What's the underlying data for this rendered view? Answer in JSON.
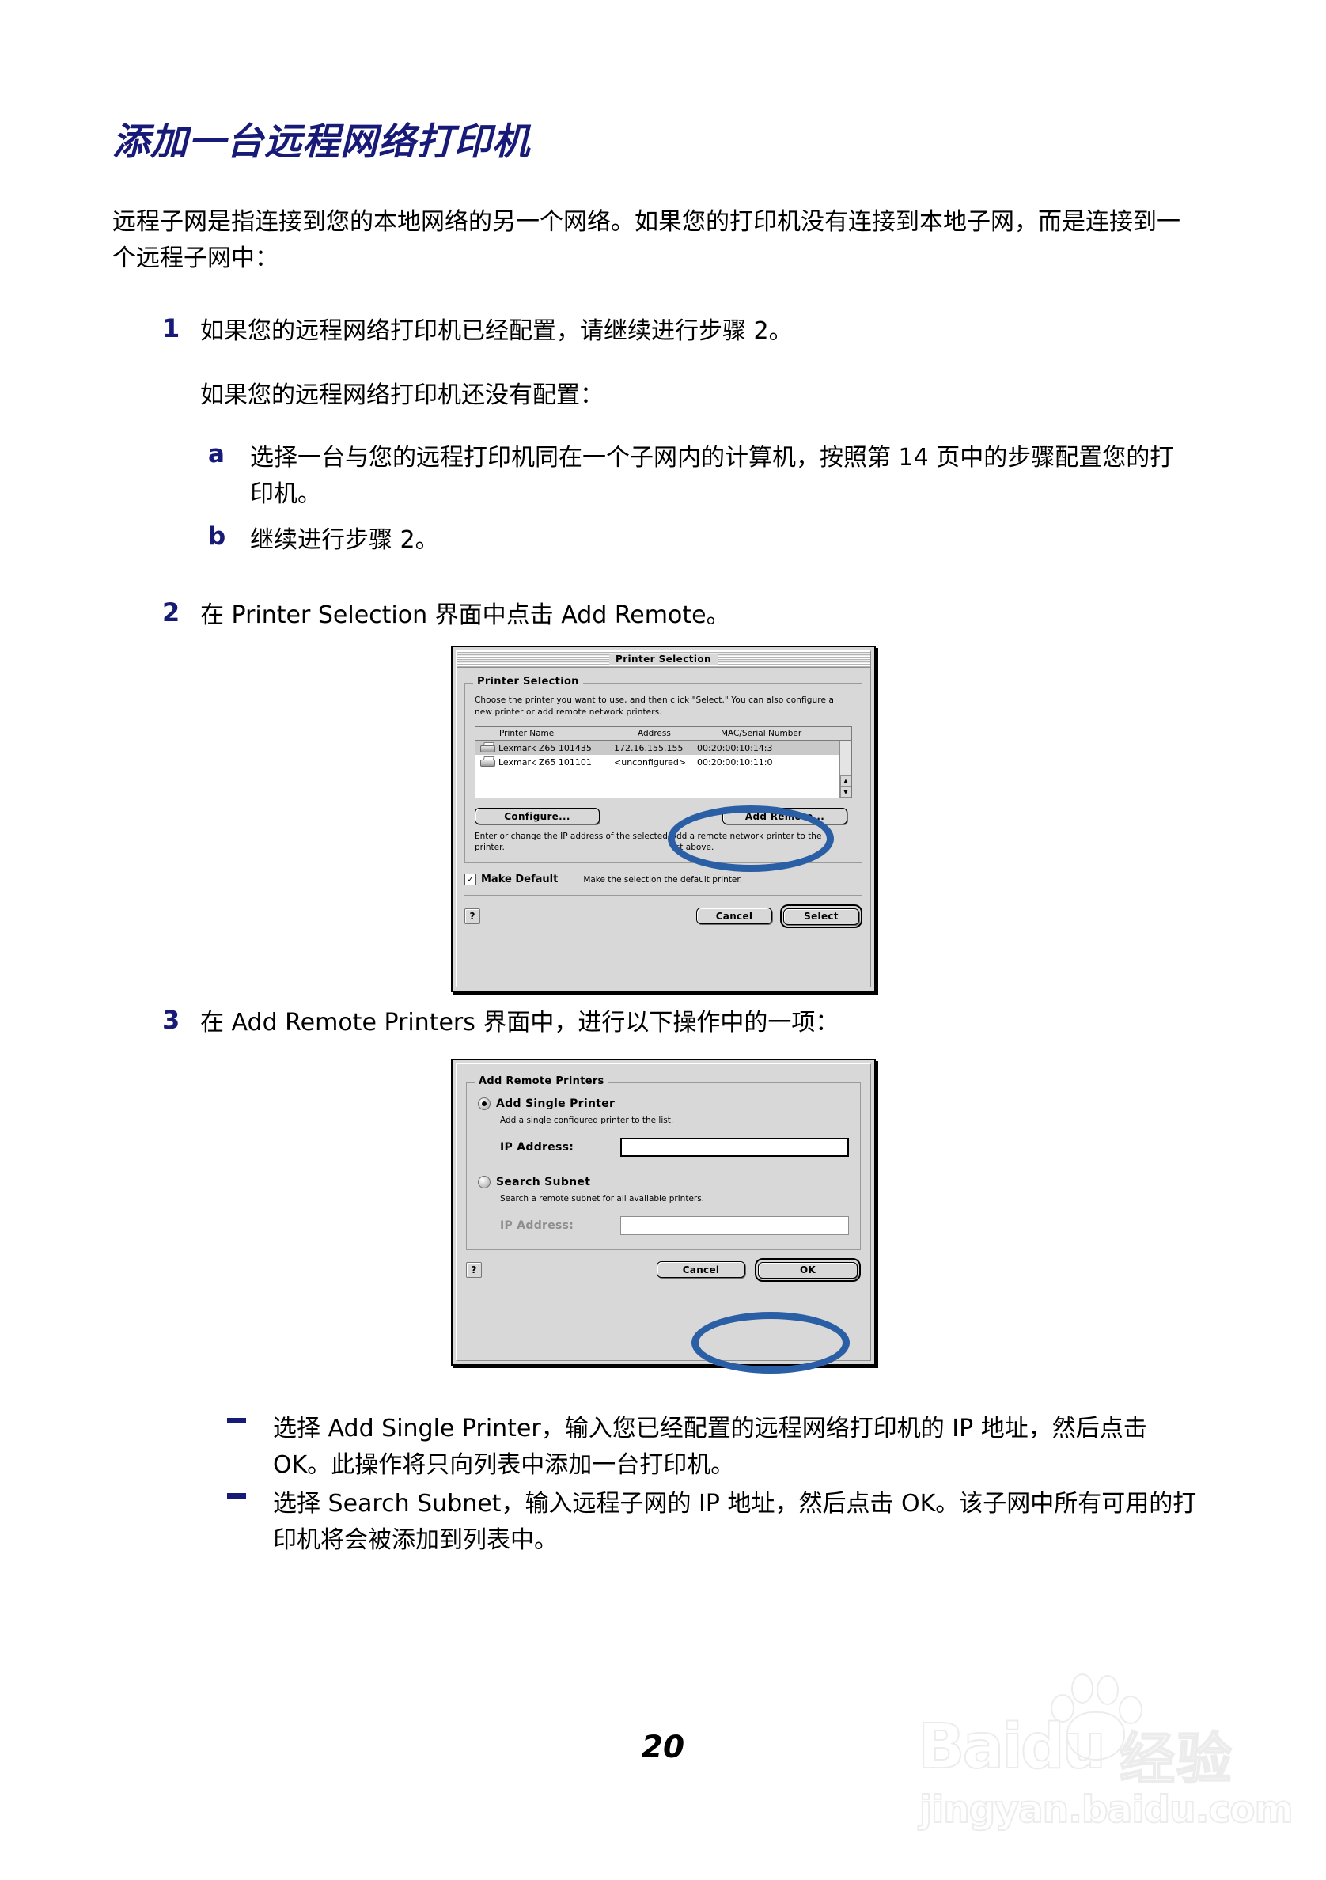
{
  "page": {
    "title": "添加一台远程网络打印机",
    "page_number": "20",
    "intro": "远程子网是指连接到您的本地网络的另一个网络。如果您的打印机没有连接到本地子网，而是连接到一个远程子网中：",
    "accent_blue": "#181a78",
    "highlight_blue": "#2b5fa5"
  },
  "steps": {
    "s1_marker": "1",
    "s1_text": "如果您的远程网络打印机已经配置，请继续进行步骤 2。",
    "s1_second": "如果您的远程网络打印机还没有配置：",
    "sa_marker": "a",
    "sa_text": "选择一台与您的远程打印机同在一个子网内的计算机，按照第 14 页中的步骤配置您的打印机。",
    "sb_marker": "b",
    "sb_text": "继续进行步骤 2。",
    "s2_marker": "2",
    "s2_text": "在 Printer Selection 界面中点击 Add Remote。",
    "s3_marker": "3",
    "s3_text": "在 Add Remote Printers 界面中，进行以下操作中的一项："
  },
  "bullets": [
    "选择 Add Single Printer，输入您已经配置的远程网络打印机的 IP 地址，然后点击 OK。此操作将只向列表中添加一台打印机。",
    "选择 Search Subnet，输入远程子网的 IP 地址，然后点击 OK。该子网中所有可用的打印机将会被添加到列表中。"
  ],
  "dialog1": {
    "window_title": "Printer Selection",
    "group_title": "Printer Selection",
    "description": "Choose the printer you want to use, and then click \"Select.\" You can also configure a new printer or add remote network printers.",
    "columns": [
      "Printer Name",
      "Address",
      "MAC/Serial Number"
    ],
    "rows": [
      {
        "name": "Lexmark Z65 101435",
        "address": "172.16.155.155",
        "mac": "00:20:00:10:14:3",
        "selected": true
      },
      {
        "name": "Lexmark Z65 101101",
        "address": "<unconfigured>",
        "mac": "00:20:00:10:11:0",
        "selected": false
      }
    ],
    "configure_button": "Configure...",
    "add_remote_button": "Add Remote...",
    "configure_hint": "Enter or change the IP address of the selected printer.",
    "add_remote_hint": "Add a remote network printer to the list above.",
    "make_default_label": "Make Default",
    "make_default_hint": "Make the selection the default printer.",
    "help_glyph": "?",
    "cancel_button": "Cancel",
    "select_button": "Select",
    "scroll_up_glyph": "▲",
    "scroll_down_glyph": "▼",
    "check_glyph": "✓"
  },
  "dialog2": {
    "group_title": "Add Remote Printers",
    "option1_label": "Add Single Printer",
    "option1_desc": "Add a single configured printer to the list.",
    "option1_ip_label": "IP Address:",
    "option1_ip_value": "",
    "option2_label": "Search Subnet",
    "option2_desc": "Search a remote subnet for all available printers.",
    "option2_ip_label": "IP Address:",
    "option2_ip_value": "",
    "help_glyph": "?",
    "cancel_button": "Cancel",
    "ok_button": "OK"
  },
  "watermark": {
    "brand": "Baidu",
    "cn": "经验",
    "url": "jingyan.baidu.com"
  }
}
